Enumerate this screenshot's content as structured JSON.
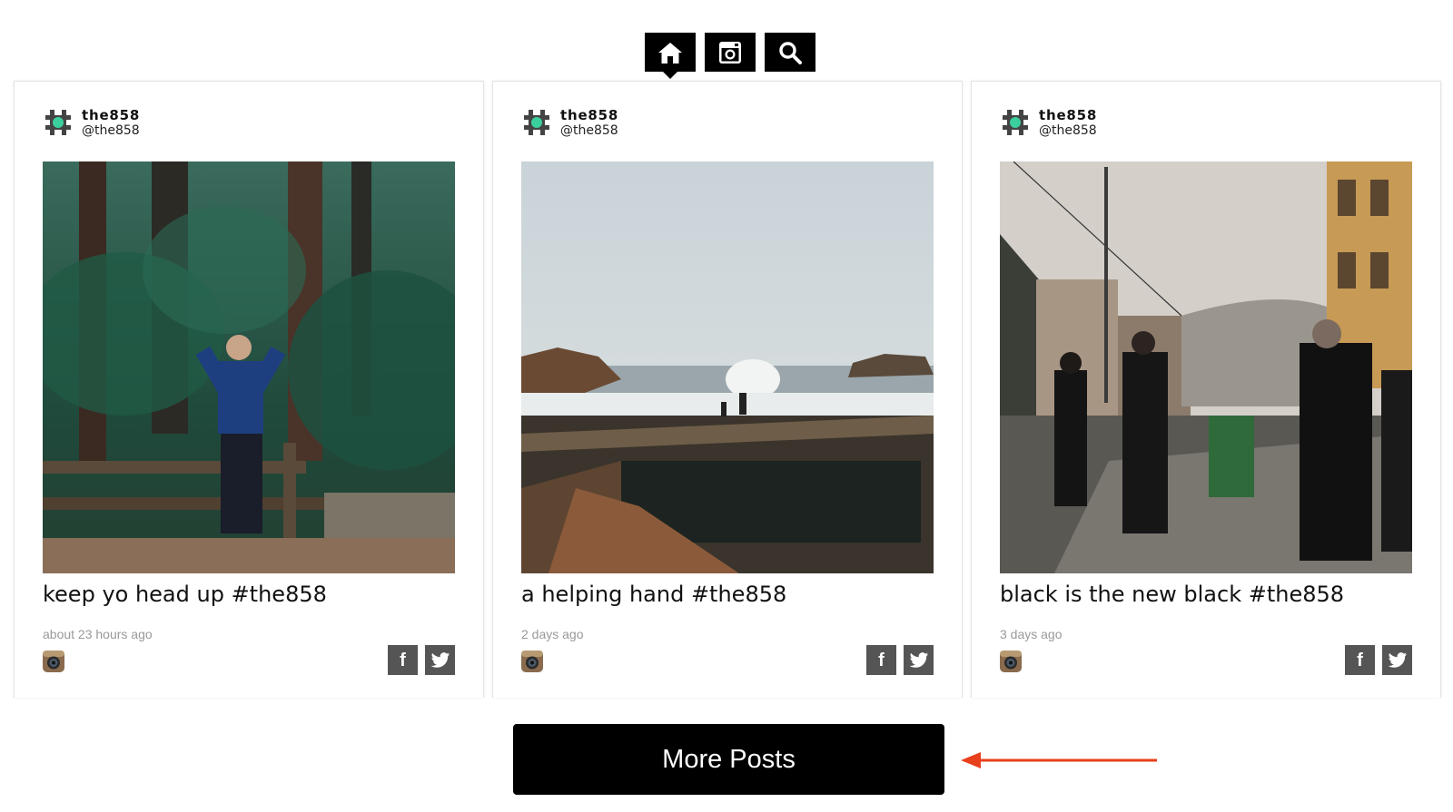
{
  "nav": {
    "items": [
      {
        "icon": "home-icon",
        "active": true
      },
      {
        "icon": "instagram-icon",
        "active": false
      },
      {
        "icon": "search-icon",
        "active": false
      }
    ]
  },
  "posts": [
    {
      "name": "the858",
      "handle": "@the858",
      "caption": "keep yo head up #the858",
      "time": "about 23 hours ago",
      "source_icon": "instagram-icon"
    },
    {
      "name": "the858",
      "handle": "@the858",
      "caption": "a helping hand #the858",
      "time": "2 days ago",
      "source_icon": "instagram-icon"
    },
    {
      "name": "the858",
      "handle": "@the858",
      "caption": "black is the new black #the858",
      "time": "3 days ago",
      "source_icon": "instagram-icon"
    }
  ],
  "share": {
    "facebook_glyph": "f",
    "twitter_icon": "twitter-icon"
  },
  "more_posts": {
    "label": "More Posts"
  },
  "colors": {
    "nav_bg": "#000000",
    "button_bg": "#000000",
    "share_bg": "#555555",
    "annotation_arrow": "#e8401c",
    "avatar_accent": "#3ccf9e"
  }
}
